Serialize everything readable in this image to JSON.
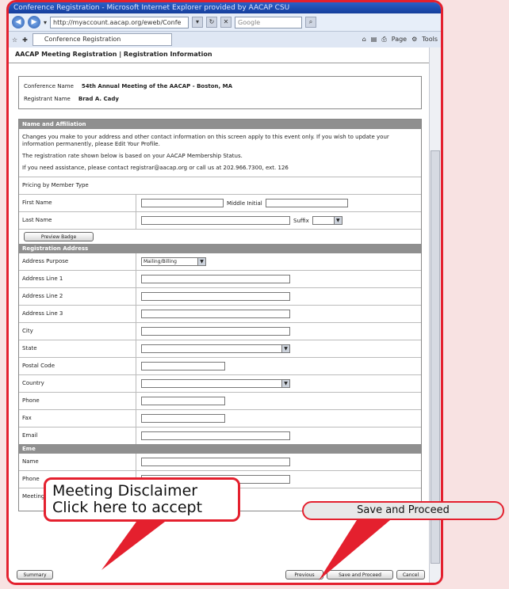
{
  "window": {
    "title": "Conference Registration - Microsoft Internet Explorer provided by AACAP CSU"
  },
  "address": {
    "url": "http://myaccount.aacap.org/eweb/Confe",
    "search_placeholder": "Google"
  },
  "tab": {
    "label": "Conference Registration",
    "page_menu": "Page",
    "tools_menu": "Tools"
  },
  "page": {
    "title": "AACAP Meeting Registration | Registration Information"
  },
  "info": {
    "conf_label": "Conference Name",
    "conf_value": "54th Annual Meeting of the AACAP - Boston, MA",
    "reg_label": "Registrant Name",
    "reg_value": "Brad A. Cady"
  },
  "name_section": {
    "header": "Name and Affiliation",
    "p1": "Changes you make to your address and other contact information on this screen apply to this event only. If you wish to update your information permanently, please Edit Your Profile.",
    "p2": "The registration rate shown below is based on your AACAP Membership Status.",
    "p3": "If you need assistance, please contact registrar@aacap.org or call us at 202.966.7300, ext. 126",
    "pricing_label": "Pricing by Member Type",
    "first_name": "First Name",
    "middle_initial": "Middle Initial",
    "last_name": "Last Name",
    "suffix": "Suffix",
    "preview_badge": "Preview Badge"
  },
  "address_section": {
    "header": "Registration Address",
    "purpose_label": "Address Purpose",
    "purpose_value": "Mailing/Billing",
    "line1": "Address Line 1",
    "line2": "Address Line 2",
    "line3": "Address Line 3",
    "city": "City",
    "state": "State",
    "postal": "Postal Code",
    "country": "Country",
    "phone": "Phone",
    "fax": "Fax",
    "email": "Email"
  },
  "emergency_section": {
    "header": "Eme",
    "name": "Name",
    "phone": "Phone",
    "disclaimer_label": "Meeting Disclaimer Click here to accept"
  },
  "buttons": {
    "summary": "Summary",
    "previous": "Previous",
    "save": "Save and Proceed",
    "cancel": "Cancel"
  },
  "callouts": {
    "disclaimer": "Meeting Disclaimer Click here to accept",
    "save": "Save and Proceed"
  }
}
